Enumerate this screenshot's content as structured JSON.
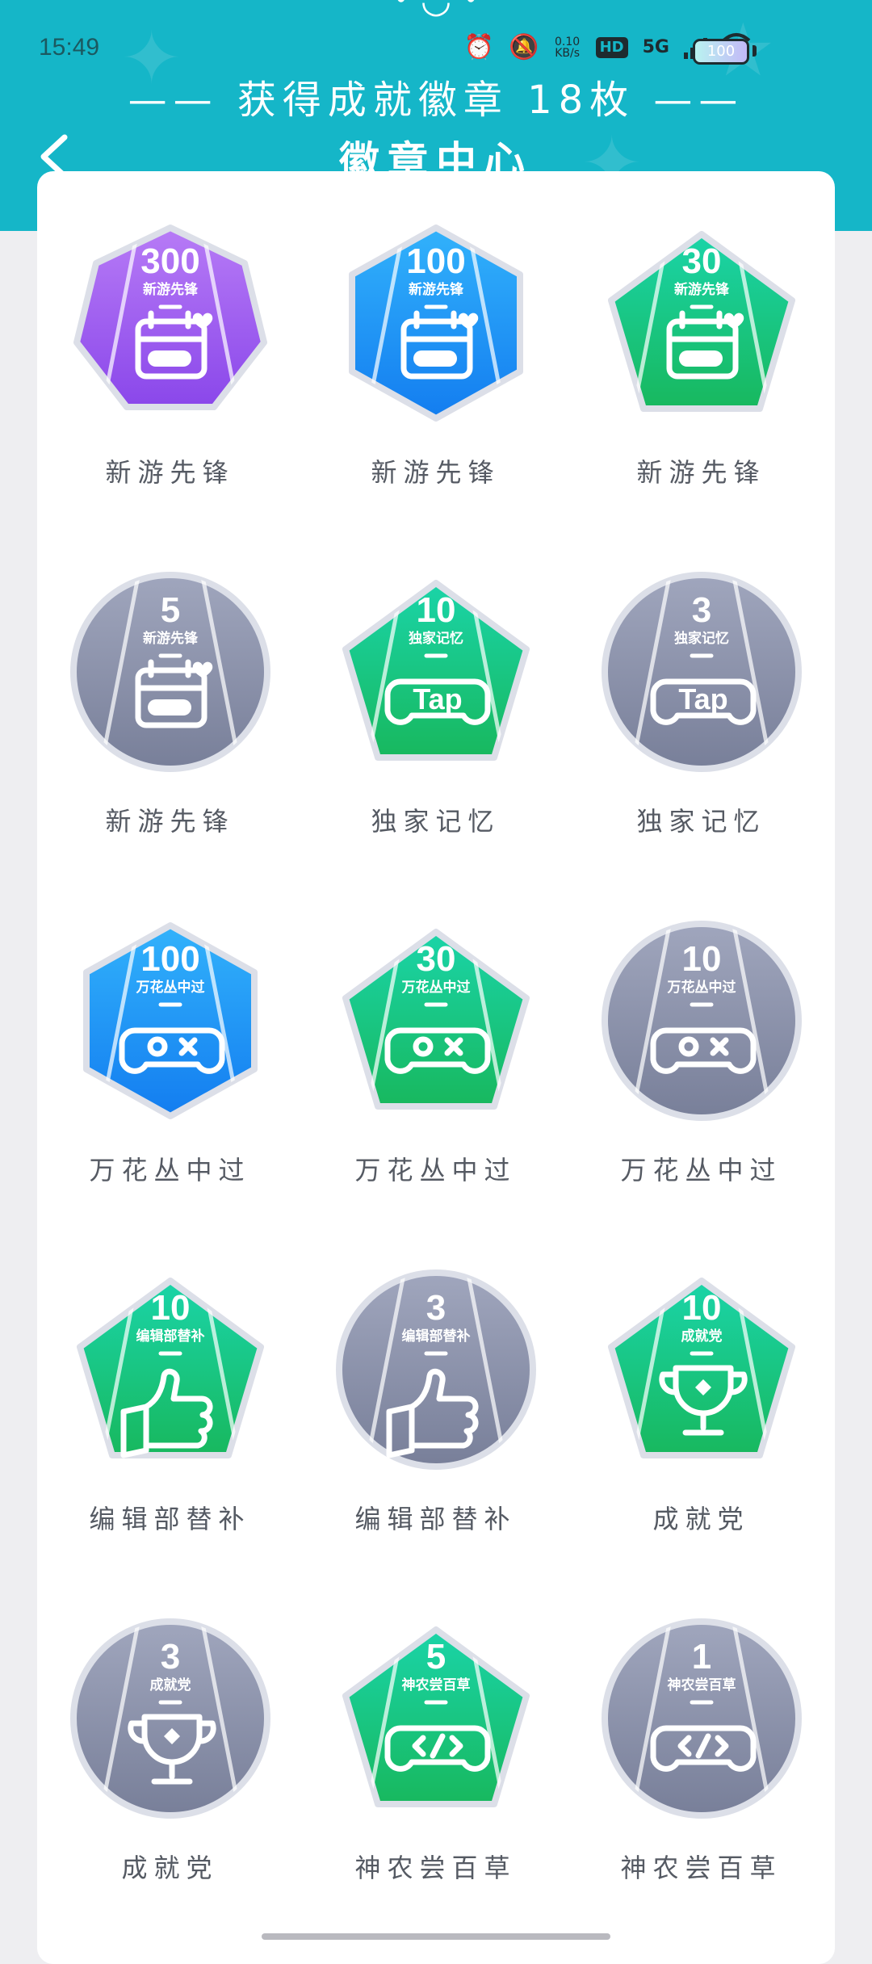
{
  "status_bar": {
    "time": "15:49",
    "net_speed_value": "0.10",
    "net_speed_unit": "KB/s",
    "hd_label": "HD",
    "network_label": "5G",
    "battery_level": "100",
    "icons": [
      "alarm-icon",
      "mute-icon",
      "hd-icon",
      "signal-icon",
      "wifi-icon",
      "battery-icon"
    ]
  },
  "header": {
    "subtitle": "—— 获得成就徽章 18枚 ——",
    "title": "徽章中心",
    "background_color": "#15b6c8"
  },
  "colors": {
    "purple": "#9a58f0",
    "blue": "#1596f2",
    "green": "#12c07e",
    "gray": "#8a90a8",
    "label": "#555a63"
  },
  "badges": [
    {
      "number": "300",
      "subtitle": "新游先锋",
      "label": "新游先锋",
      "shape": "heptagon",
      "color": "purple",
      "icon": "calendar-gamepad-icon"
    },
    {
      "number": "100",
      "subtitle": "新游先锋",
      "label": "新游先锋",
      "shape": "hexagon",
      "color": "blue",
      "icon": "calendar-gamepad-icon"
    },
    {
      "number": "30",
      "subtitle": "新游先锋",
      "label": "新游先锋",
      "shape": "pentagon",
      "color": "green",
      "icon": "calendar-gamepad-icon"
    },
    {
      "number": "5",
      "subtitle": "新游先锋",
      "label": "新游先锋",
      "shape": "circle",
      "color": "gray",
      "icon": "calendar-gamepad-icon"
    },
    {
      "number": "10",
      "subtitle": "独家记忆",
      "label": "独家记忆",
      "shape": "pentagon",
      "color": "green",
      "icon": "tap-controller-icon"
    },
    {
      "number": "3",
      "subtitle": "独家记忆",
      "label": "独家记忆",
      "shape": "circle",
      "color": "gray",
      "icon": "tap-controller-icon"
    },
    {
      "number": "100",
      "subtitle": "万花丛中过",
      "label": "万花丛中过",
      "shape": "hexagon",
      "color": "blue",
      "icon": "gamepad-icon"
    },
    {
      "number": "30",
      "subtitle": "万花丛中过",
      "label": "万花丛中过",
      "shape": "pentagon",
      "color": "green",
      "icon": "gamepad-icon"
    },
    {
      "number": "10",
      "subtitle": "万花丛中过",
      "label": "万花丛中过",
      "shape": "circle",
      "color": "gray",
      "icon": "gamepad-icon"
    },
    {
      "number": "10",
      "subtitle": "编辑部替补",
      "label": "编辑部替补",
      "shape": "pentagon",
      "color": "green",
      "icon": "thumbs-up-icon"
    },
    {
      "number": "3",
      "subtitle": "编辑部替补",
      "label": "编辑部替补",
      "shape": "circle",
      "color": "gray",
      "icon": "thumbs-up-icon"
    },
    {
      "number": "10",
      "subtitle": "成就党",
      "label": "成就党",
      "shape": "pentagon",
      "color": "green",
      "icon": "trophy-icon"
    },
    {
      "number": "3",
      "subtitle": "成就党",
      "label": "成就党",
      "shape": "circle",
      "color": "gray",
      "icon": "trophy-icon"
    },
    {
      "number": "5",
      "subtitle": "神农尝百草",
      "label": "神农尝百草",
      "shape": "pentagon",
      "color": "green",
      "icon": "code-controller-icon"
    },
    {
      "number": "1",
      "subtitle": "神农尝百草",
      "label": "神农尝百草",
      "shape": "circle",
      "color": "gray",
      "icon": "code-controller-icon"
    }
  ]
}
